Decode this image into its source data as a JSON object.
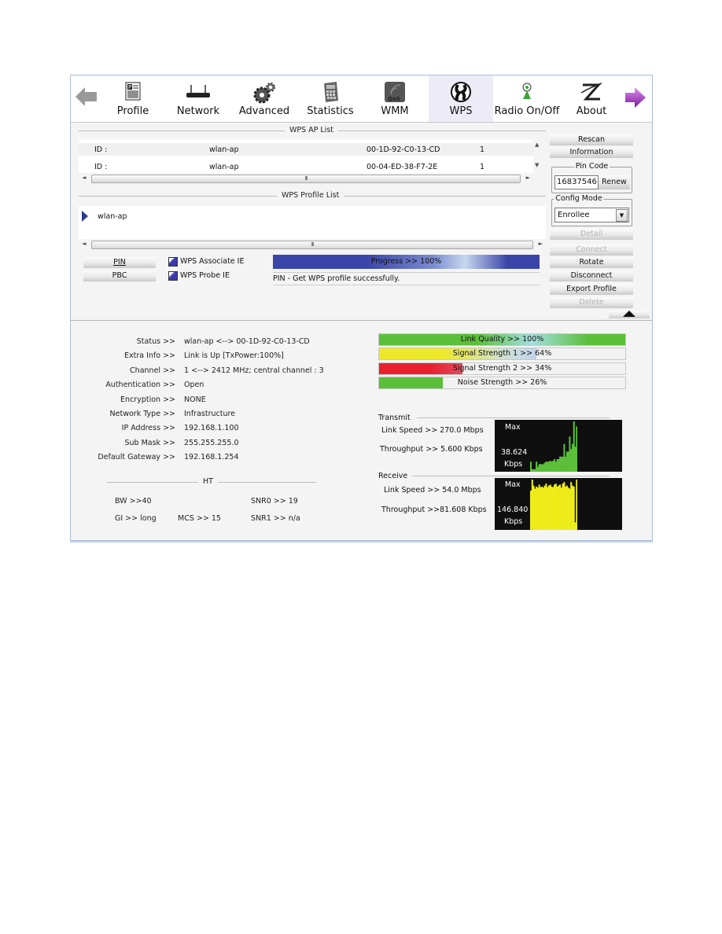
{
  "toolbar": {
    "back_icon": "arrow-left-icon",
    "forward_icon": "arrow-right-icon",
    "items": [
      {
        "label": "Profile",
        "icon": "profile-document-icon",
        "active": false
      },
      {
        "label": "Network",
        "icon": "router-icon",
        "active": false
      },
      {
        "label": "Advanced",
        "icon": "gears-icon",
        "active": false
      },
      {
        "label": "Statistics",
        "icon": "calculator-icon",
        "active": false
      },
      {
        "label": "WMM",
        "icon": "qos-icon",
        "active": false
      },
      {
        "label": "WPS",
        "icon": "wps-icon",
        "active": true
      },
      {
        "label": "Radio On/Off",
        "icon": "radio-antenna-icon",
        "active": false
      },
      {
        "label": "About",
        "icon": "about-logo-icon",
        "active": false
      }
    ]
  },
  "ap_list": {
    "title": "WPS AP List",
    "rows": [
      {
        "id_label": "ID :",
        "ssid": "wlan-ap",
        "bssid": "00-1D-92-C0-13-CD",
        "channel": "1"
      },
      {
        "id_label": "ID :",
        "ssid": "wlan-ap",
        "bssid": "00-04-ED-38-F7-2E",
        "channel": "1"
      }
    ],
    "scroll_grip": "III"
  },
  "profile_list": {
    "title": "WPS Profile List",
    "items": [
      "wlan-ap"
    ],
    "scroll_grip": "III"
  },
  "actions": {
    "pin_label": "PIN",
    "pbc_label": "PBC",
    "associate_ie_label": "WPS Associate IE",
    "associate_ie_checked": true,
    "probe_ie_label": "WPS Probe IE",
    "probe_ie_checked": true,
    "progress_text": "Progress >> 100%",
    "progress_value": 100,
    "status_message": "PIN - Get WPS profile successfully."
  },
  "side": {
    "rescan": "Rescan",
    "information": "Information",
    "pin_code_title": "Pin Code",
    "pin_code_value": "16837546",
    "renew": "Renew",
    "config_mode_title": "Config Mode",
    "config_mode_value": "Enrollee",
    "detail": "Detail",
    "connect": "Connect",
    "rotate": "Rotate",
    "disconnect": "Disconnect",
    "export_profile": "Export Profile",
    "delete": "Delete"
  },
  "status": {
    "rows": [
      {
        "label": "Status >>",
        "value": "wlan-ap <--> 00-1D-92-C0-13-CD"
      },
      {
        "label": "Extra Info >>",
        "value": "Link is Up [TxPower:100%]"
      },
      {
        "label": "Channel >>",
        "value": "1 <--> 2412 MHz; central channel : 3"
      },
      {
        "label": "Authentication >>",
        "value": "Open"
      },
      {
        "label": "Encryption >>",
        "value": "NONE"
      },
      {
        "label": "Network Type >>",
        "value": "Infrastructure"
      },
      {
        "label": "IP Address >>",
        "value": "192.168.1.100"
      },
      {
        "label": "Sub Mask >>",
        "value": "255.255.255.0"
      },
      {
        "label": "Default Gateway >>",
        "value": "192.168.1.254"
      }
    ]
  },
  "meters": [
    {
      "label": "Link Quality >> 100%",
      "value": 100,
      "color": "#5bbf3a"
    },
    {
      "label": "Signal Strength 1 >> 64%",
      "value": 64,
      "color": "#eee82a"
    },
    {
      "label": "Signal Strength 2 >> 34%",
      "value": 34,
      "color": "#e8202e"
    },
    {
      "label": "Noise Strength >> 26%",
      "value": 26,
      "color": "#5bbf3a"
    }
  ],
  "ht": {
    "title": "HT",
    "bw": "BW >>40",
    "gi": "GI >> long",
    "mcs": "MCS >>   15",
    "snr0": "SNR0 >>  19",
    "snr1": "SNR1 >>  n/a"
  },
  "transmit": {
    "title": "Transmit",
    "link_speed": "Link Speed >>  270.0 Mbps",
    "throughput": "Throughput >>  5.600 Kbps",
    "graph_max_label": "Max",
    "graph_value": "38.624",
    "graph_unit": "Kbps",
    "graph_color": "#5bbf3a",
    "samples": [
      0.2,
      0.05,
      0.05,
      0.05,
      0.2,
      0.1,
      0.15,
      0.15,
      0.15,
      0.15,
      0.18,
      0.2,
      0.2,
      0.2,
      0.22,
      0.2,
      0.22,
      0.25,
      0.2,
      0.25,
      0.25,
      0.3,
      0.3,
      0.3,
      0.55,
      0.3,
      0.4,
      0.4,
      0.7,
      0.45,
      0.55,
      1.0,
      0.5,
      0.9
    ]
  },
  "receive": {
    "title": "Receive",
    "link_speed": "Link Speed >> 54.0 Mbps",
    "throughput": "Throughput >>81.608 Kbps",
    "graph_max_label": "Max",
    "graph_value": "146.840",
    "graph_unit": "Kbps",
    "graph_color": "#eeec19",
    "samples": [
      0.78,
      1.0,
      0.88,
      0.82,
      0.86,
      0.84,
      0.9,
      0.85,
      0.86,
      0.84,
      0.88,
      0.92,
      0.85,
      0.88,
      0.9,
      0.86,
      0.85,
      0.9,
      0.92,
      0.86,
      0.88,
      0.9,
      0.84,
      0.92,
      0.95,
      0.86,
      0.88,
      0.84,
      0.82,
      0.95,
      0.88,
      0.86,
      0.15,
      1.0
    ]
  }
}
